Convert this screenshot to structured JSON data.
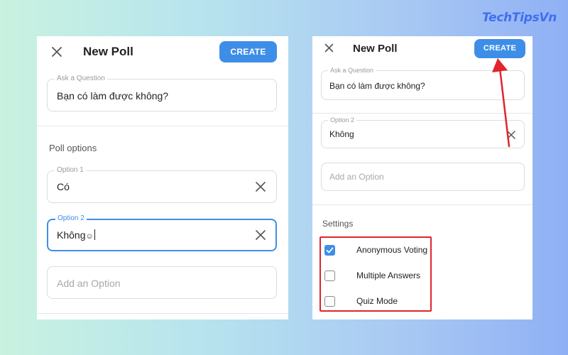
{
  "brand": {
    "text": "TechTipsVn"
  },
  "left_panel": {
    "title": "New Poll",
    "create_label": "CREATE",
    "question": {
      "label": "Ask a Question",
      "value": "Bạn có làm được không?"
    },
    "poll_options_title": "Poll options",
    "options": [
      {
        "label": "Option 1",
        "value": "Có"
      },
      {
        "label": "Option 2",
        "value": "Không",
        "focused": true
      }
    ],
    "add_option_placeholder": "Add an Option"
  },
  "right_panel": {
    "title": "New Poll",
    "create_label": "CREATE",
    "question": {
      "label": "Ask a Question",
      "value": "Bạn có làm được không?"
    },
    "option2": {
      "label": "Option 2",
      "value": "Không"
    },
    "add_option_placeholder": "Add an Option",
    "settings_title": "Settings",
    "settings": [
      {
        "label": "Anonymous Voting",
        "checked": true
      },
      {
        "label": "Multiple Answers",
        "checked": false
      },
      {
        "label": "Quiz Mode",
        "checked": false
      }
    ]
  },
  "colors": {
    "accent": "#3e8ee8",
    "annotation": "#e0252b",
    "brand": "#3f6ff0"
  },
  "icons": [
    "close-icon",
    "clear-icon",
    "check-icon",
    "smiley-icon"
  ]
}
